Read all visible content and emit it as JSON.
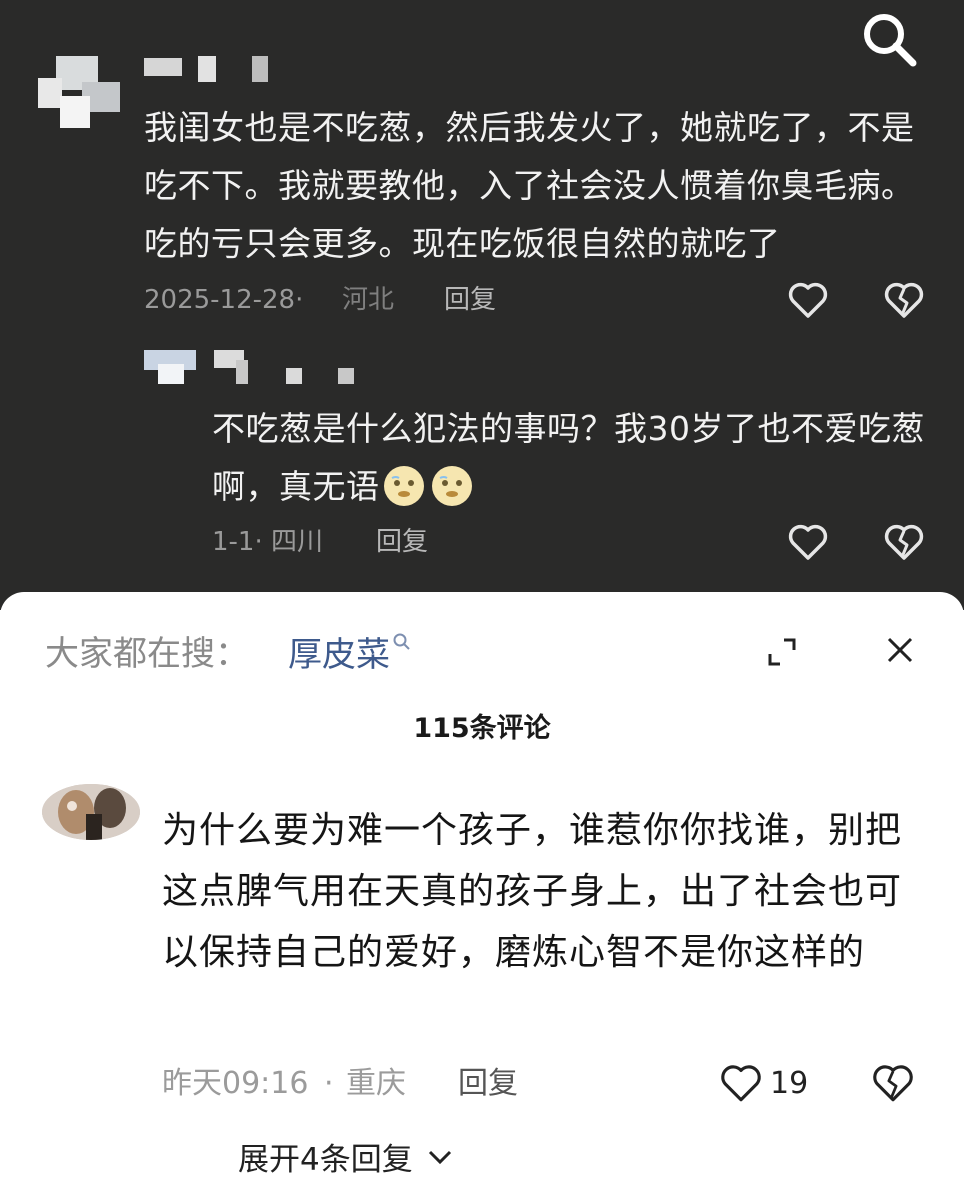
{
  "top": {
    "comment1": {
      "text": "我闺女也是不吃葱，然后我发火了，她就吃了，不是吃不下。我就要教他，入了社会没人惯着你臭毛病。吃的亏只会更多。现在吃饭很自然的就吃了",
      "date": "2025-12-28·",
      "location": "河北",
      "reply_label": "回复"
    },
    "comment2": {
      "text": "不吃葱是什么犯法的事吗？我30岁了也不爱吃葱啊，真无语",
      "date_location": "1-1· 四川",
      "reply_label": "回复"
    }
  },
  "sheet": {
    "hot_search_prefix": "大家都在搜：",
    "hot_search_term": "厚皮菜",
    "comment_count": "115条评论",
    "comment": {
      "text": "为什么要为难一个孩子，谁惹你你找谁，别把这点脾气用在天真的孩子身上，出了社会也可以保持自己的爱好，磨炼心智不是你这样的",
      "time": "昨天09:16",
      "separator": "·",
      "location": "重庆",
      "reply_label": "回复",
      "like_count": "19"
    },
    "expand_label": "展开4条回复"
  },
  "colors": {
    "dark_bg": "#2a2a29",
    "link_blue": "#3e5a8c"
  },
  "icons": [
    "search-icon",
    "heart-outline-icon",
    "broken-heart-icon",
    "emoji-icon",
    "minimize-icon",
    "close-icon",
    "chevron-down-icon"
  ]
}
